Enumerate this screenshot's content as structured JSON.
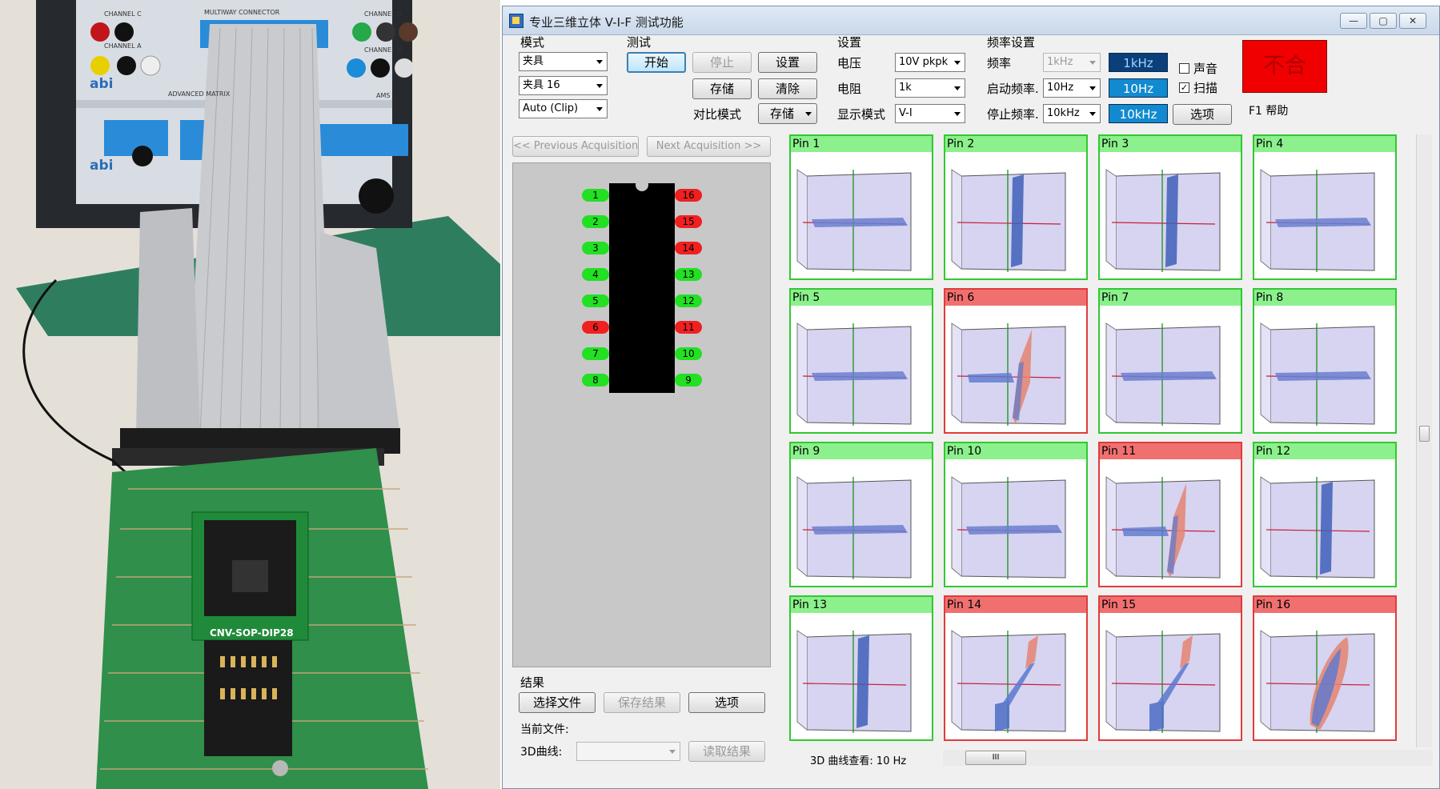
{
  "photo": {
    "board_labels": [
      "CHANNEL C",
      "CHANNEL D",
      "CHANNEL A",
      "CHANNEL B",
      "MULTIWAY CONNECTOR",
      "ADVANCED MATRIX",
      "AMS",
      "abi",
      "abi"
    ],
    "adapter_label": "CNV-SOP-DIP28"
  },
  "window": {
    "title": "专业三维立体 V-I-F 测试功能",
    "controls": [
      "minimize",
      "maximize",
      "close"
    ]
  },
  "mode_group": {
    "label": "模式",
    "fixture": "夹具",
    "fixture_size": "夹具 16",
    "clip": "Auto (Clip)"
  },
  "test_group": {
    "label": "测试",
    "start": "开始",
    "stop": "停止",
    "settings": "设置",
    "save": "存储",
    "clear": "清除",
    "compare_label": "对比模式",
    "compare_value": "存储"
  },
  "settings_group": {
    "label": "设置",
    "voltage_label": "电压",
    "voltage_value": "10V pkpk",
    "resistance_label": "电阻",
    "resistance_value": "1k",
    "display_label": "显示模式",
    "display_value": "V-I"
  },
  "freq_group": {
    "label": "频率设置",
    "freq_label": "频率",
    "freq_value": "1kHz",
    "freq_readout": "1kHz",
    "start_label": "启动频率.",
    "start_value": "10Hz",
    "start_readout": "10Hz",
    "stop_label": "停止频率.",
    "stop_value": "10kHz",
    "stop_readout": "10kHz",
    "sound_label": "声音",
    "sound_checked": false,
    "scan_label": "扫描",
    "scan_checked": true,
    "options": "选项"
  },
  "status": {
    "result_text": "不合",
    "color": "#f00000",
    "help": "F1 帮助"
  },
  "nav": {
    "prev": "<< Previous Acquisition",
    "next": "Next Acquisition >>"
  },
  "chip": {
    "left_pins": [
      {
        "num": "1",
        "state": "pass"
      },
      {
        "num": "2",
        "state": "pass"
      },
      {
        "num": "3",
        "state": "pass"
      },
      {
        "num": "4",
        "state": "pass"
      },
      {
        "num": "5",
        "state": "pass"
      },
      {
        "num": "6",
        "state": "fail"
      },
      {
        "num": "7",
        "state": "pass"
      },
      {
        "num": "8",
        "state": "pass"
      }
    ],
    "right_pins": [
      {
        "num": "16",
        "state": "fail"
      },
      {
        "num": "15",
        "state": "fail"
      },
      {
        "num": "14",
        "state": "fail"
      },
      {
        "num": "13",
        "state": "pass"
      },
      {
        "num": "12",
        "state": "pass"
      },
      {
        "num": "11",
        "state": "fail"
      },
      {
        "num": "10",
        "state": "pass"
      },
      {
        "num": "9",
        "state": "pass"
      }
    ],
    "pass_color": "#22e022",
    "fail_color": "#f02020"
  },
  "results": {
    "label": "结果",
    "select_file": "选择文件",
    "save_result": "保存结果",
    "options": "选项",
    "current_file_label": "当前文件:",
    "curve_label": "3D曲线:",
    "curve_value": "",
    "read_result": "读取结果"
  },
  "pins": [
    {
      "label": "Pin 1",
      "state": "pass",
      "shape": "flat"
    },
    {
      "label": "Pin 2",
      "state": "pass",
      "shape": "wall"
    },
    {
      "label": "Pin 3",
      "state": "pass",
      "shape": "wall"
    },
    {
      "label": "Pin 4",
      "state": "pass",
      "shape": "flat"
    },
    {
      "label": "Pin 5",
      "state": "pass",
      "shape": "flat"
    },
    {
      "label": "Pin 6",
      "state": "fail",
      "shape": "diode"
    },
    {
      "label": "Pin 7",
      "state": "pass",
      "shape": "flat"
    },
    {
      "label": "Pin 8",
      "state": "pass",
      "shape": "flat"
    },
    {
      "label": "Pin 9",
      "state": "pass",
      "shape": "flat"
    },
    {
      "label": "Pin 10",
      "state": "pass",
      "shape": "flat"
    },
    {
      "label": "Pin 11",
      "state": "fail",
      "shape": "diode"
    },
    {
      "label": "Pin 12",
      "state": "pass",
      "shape": "wall"
    },
    {
      "label": "Pin 13",
      "state": "pass",
      "shape": "wall"
    },
    {
      "label": "Pin 14",
      "state": "fail",
      "shape": "zener"
    },
    {
      "label": "Pin 15",
      "state": "fail",
      "shape": "zener"
    },
    {
      "label": "Pin 16",
      "state": "fail",
      "shape": "blob"
    }
  ],
  "footer": {
    "curve_view": "3D 曲线查看:  10 Hz",
    "scroll_thumb": "III"
  }
}
